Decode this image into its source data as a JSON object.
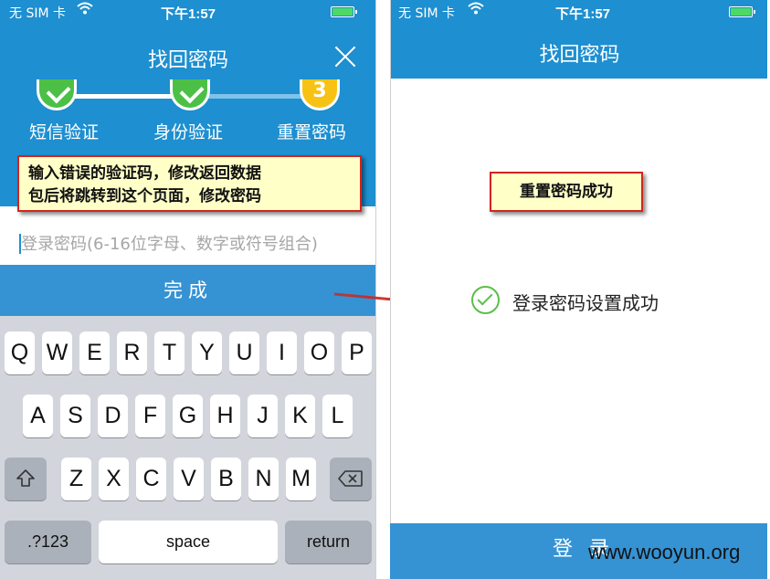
{
  "left_screen": {
    "status_bar": {
      "carrier": "无 SIM 卡",
      "time": "下午1:57"
    },
    "title": "找回密码",
    "steps": [
      {
        "label": "短信验证",
        "state": "done"
      },
      {
        "label": "身份验证",
        "state": "done"
      },
      {
        "label": "重置密码",
        "state": "current",
        "number": "3"
      }
    ],
    "callout_lines": [
      "输入错误的验证码，修改返回数据",
      "包后将跳转到这个页面，修改密码"
    ],
    "password_placeholder": "登录密码(6-16位字母、数字或符号组合)",
    "done_button": "完成",
    "keyboard": {
      "row1": [
        "Q",
        "W",
        "E",
        "R",
        "T",
        "Y",
        "U",
        "I",
        "O",
        "P"
      ],
      "row2": [
        "A",
        "S",
        "D",
        "F",
        "G",
        "H",
        "J",
        "K",
        "L"
      ],
      "row3": [
        "Z",
        "X",
        "C",
        "V",
        "B",
        "N",
        "M"
      ],
      "numbers_key": ".?123",
      "space_key": "space",
      "return_key": "return"
    }
  },
  "right_screen": {
    "status_bar": {
      "carrier": "无 SIM 卡",
      "time": "下午1:57"
    },
    "title": "找回密码",
    "callout": "重置密码成功",
    "success_message": "登录密码设置成功",
    "login_button": "登录"
  },
  "watermark": "www.wooyun.org",
  "colors": {
    "header_blue": "#1e8fd0",
    "button_blue": "#3593d4",
    "step_done": "#4cc046",
    "step_current": "#f7c213",
    "callout_bg": "#ffffc8",
    "callout_border": "#d0251f",
    "arrow": "#d0251f"
  }
}
